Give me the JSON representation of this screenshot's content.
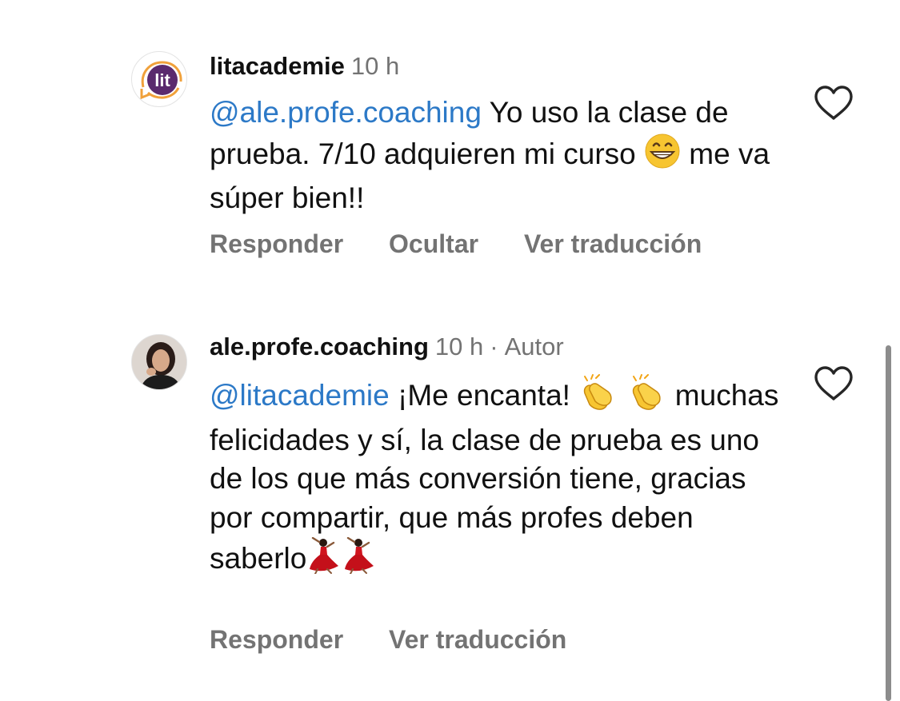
{
  "comments": [
    {
      "username": "litacademie",
      "time": "10 h",
      "avatar_text": "lit",
      "mention": "@ale.profe.coaching",
      "text_1": "Yo uso la clase de prueba. 7/10 adquieren mi curso",
      "emoji_1": "grinning-face-emoji",
      "text_2": "me va súper bien!!",
      "actions": [
        "Responder",
        "Ocultar",
        "Ver traducción"
      ],
      "liked": false
    },
    {
      "username": "ale.profe.coaching",
      "time": "10 h",
      "badge": "Autor",
      "mention": "@litacademie",
      "text_1": "¡Me encanta!",
      "emoji_1": "clapping-hands-emoji",
      "text_2": "muchas felicidades y sí, la clase de prueba es uno de los que más conversión tiene, gracias por compartir, que más profes deben saberlo",
      "emoji_2": "dancer-emoji",
      "actions": [
        "Responder",
        "Ver traducción"
      ],
      "liked": false
    }
  ],
  "colors": {
    "mention": "#2c79c7",
    "secondary_text": "#737373",
    "brand_purple": "#5a2a6e",
    "brand_orange": "#f0a13b"
  }
}
